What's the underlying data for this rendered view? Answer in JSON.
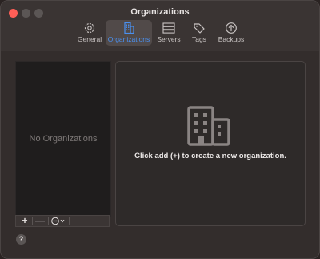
{
  "window": {
    "title": "Organizations"
  },
  "toolbar": {
    "items": [
      {
        "label": "General",
        "icon": "gear-icon"
      },
      {
        "label": "Organizations",
        "icon": "building-icon",
        "active": true
      },
      {
        "label": "Servers",
        "icon": "server-icon"
      },
      {
        "label": "Tags",
        "icon": "tag-icon"
      },
      {
        "label": "Backups",
        "icon": "arrow-up-circle-icon"
      }
    ]
  },
  "sidebar": {
    "empty_text": "No Organizations",
    "add_label": "+",
    "remove_label": "—"
  },
  "main": {
    "message": "Click add (+) to create a new organization."
  },
  "help": {
    "label": "?"
  },
  "colors": {
    "accent": "#4a90f0",
    "close": "#ff5f57"
  }
}
